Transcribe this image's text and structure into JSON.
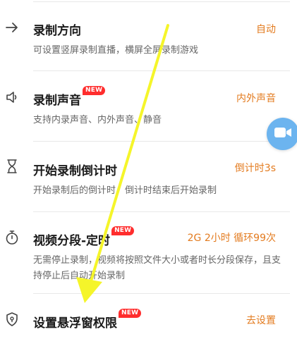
{
  "settings": [
    {
      "icon": "arrow-right-icon",
      "title": "录制方向",
      "badge": "",
      "value": "自动",
      "desc": "可设置竖屏录制直播，横屏全屏录制游戏"
    },
    {
      "icon": "speaker-icon",
      "title": "录制声音",
      "badge": "NEW",
      "value": "内外声音",
      "desc": "支持内录声音、内外声音、静音"
    },
    {
      "icon": "hourglass-icon",
      "title": "开始录制倒计时",
      "badge": "",
      "value": "倒计时3s",
      "desc": "开始录制后的倒计时，倒计时结束后开始录制"
    },
    {
      "icon": "stopwatch-icon",
      "title": "视频分段-定时",
      "badge": "NEW",
      "value": "2G 2小时 循环99次",
      "desc": "无需停止录制，视频将按照文件大小或者时长分段保存，且支持停止后自动开始录制"
    },
    {
      "icon": "shield-icon",
      "title": "设置悬浮窗权限",
      "badge": "NEW",
      "value": "去设置",
      "desc": ""
    }
  ],
  "colors": {
    "accent": "#e37b1f",
    "badge": "#ff2d2d",
    "float_button": "#6cb4ef",
    "annotation_arrow": "#f5f52a"
  },
  "float_button": {
    "icon": "video-camera-icon"
  }
}
